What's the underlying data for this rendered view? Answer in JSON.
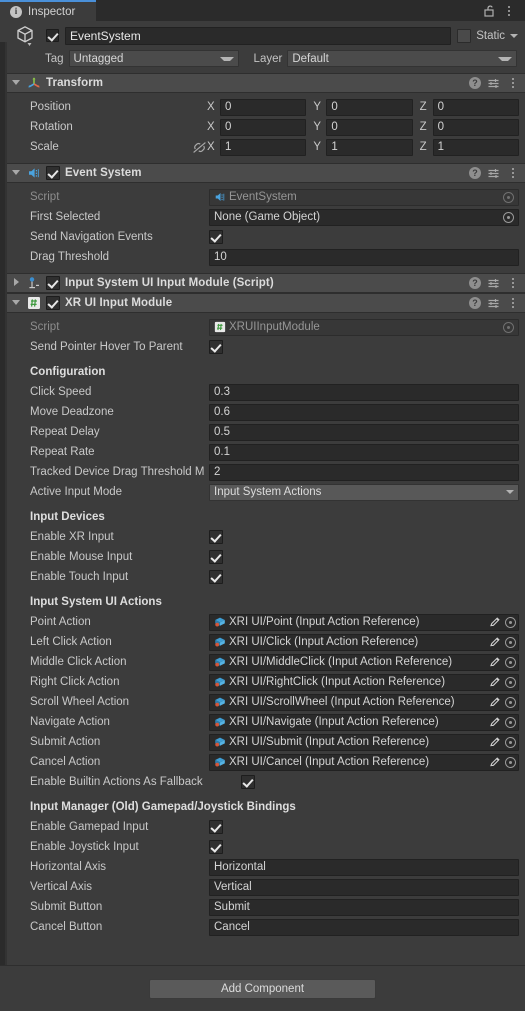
{
  "window": {
    "tab_label": "Inspector",
    "tab_icon": "info-icon",
    "lock_icon": "lock-open-icon",
    "menu_icon": "kebab-menu-icon",
    "accent_color": "#4a90d9"
  },
  "gameobject": {
    "icon": "cube-icon",
    "enabled": true,
    "name": "EventSystem",
    "static_label": "Static",
    "static_checked": false,
    "tag_label": "Tag",
    "tag_value": "Untagged",
    "layer_label": "Layer",
    "layer_value": "Default"
  },
  "components": [
    {
      "id": "transform",
      "title": "Transform",
      "icon": "transform-axis-icon",
      "expanded": true,
      "has_checkbox": false,
      "header_icons": [
        "help-icon",
        "preset-icon",
        "kebab-menu-icon"
      ],
      "vectors": [
        {
          "label": "Position",
          "x": "0",
          "y": "0",
          "z": "0",
          "link": false
        },
        {
          "label": "Rotation",
          "x": "0",
          "y": "0",
          "z": "0",
          "link": false
        },
        {
          "label": "Scale",
          "x": "1",
          "y": "1",
          "z": "1",
          "link": true,
          "link_icon": "constrained-proportions-off-icon"
        }
      ],
      "axis_labels": [
        "X",
        "Y",
        "Z"
      ]
    },
    {
      "id": "event-system",
      "title": "Event System",
      "icon": "event-system-icon",
      "expanded": true,
      "has_checkbox": true,
      "checked": true,
      "header_icons": [
        "help-icon",
        "preset-icon",
        "kebab-menu-icon"
      ],
      "rows": [
        {
          "type": "object",
          "label": "Script",
          "value": "EventSystem",
          "readonly": true,
          "icon": "event-system-icon"
        },
        {
          "type": "object",
          "label": "First Selected",
          "value": "None (Game Object)",
          "readonly": false
        },
        {
          "type": "bool",
          "label": "Send Navigation Events",
          "value": true
        },
        {
          "type": "text",
          "label": "Drag Threshold",
          "value": "10"
        }
      ]
    },
    {
      "id": "input-system-ui-input-module",
      "title": "Input System UI Input Module (Script)",
      "icon": "input-system-icon",
      "expanded": false,
      "has_checkbox": true,
      "checked": true,
      "header_icons": [
        "help-icon",
        "preset-icon",
        "kebab-menu-icon"
      ],
      "rows": []
    },
    {
      "id": "xr-ui-input-module",
      "title": "XR UI Input Module",
      "icon": "csharp-script-icon",
      "expanded": true,
      "has_checkbox": true,
      "checked": true,
      "header_icons": [
        "help-icon",
        "preset-icon",
        "kebab-menu-icon"
      ],
      "rows": [
        {
          "type": "object",
          "label": "Script",
          "value": "XRUIInputModule",
          "readonly": true,
          "icon": "csharp-script-icon"
        },
        {
          "type": "bool",
          "label": "Send Pointer Hover To Parent",
          "value": true
        },
        {
          "type": "header",
          "label": "Configuration"
        },
        {
          "type": "text",
          "label": "Click Speed",
          "value": "0.3"
        },
        {
          "type": "text",
          "label": "Move Deadzone",
          "value": "0.6"
        },
        {
          "type": "text",
          "label": "Repeat Delay",
          "value": "0.5"
        },
        {
          "type": "text",
          "label": "Repeat Rate",
          "value": "0.1"
        },
        {
          "type": "text",
          "label": "Tracked Device Drag Threshold M",
          "value": "2"
        },
        {
          "type": "dropdown",
          "label": "Active Input Mode",
          "value": "Input System Actions"
        },
        {
          "type": "header",
          "label": "Input Devices"
        },
        {
          "type": "bool",
          "label": "Enable XR Input",
          "value": true
        },
        {
          "type": "bool",
          "label": "Enable Mouse Input",
          "value": true
        },
        {
          "type": "bool",
          "label": "Enable Touch Input",
          "value": true
        },
        {
          "type": "header",
          "label": "Input System UI Actions"
        },
        {
          "type": "action",
          "label": "Point Action",
          "value": "XRI UI/Point (Input Action Reference)"
        },
        {
          "type": "action",
          "label": "Left Click Action",
          "value": "XRI UI/Click (Input Action Reference)"
        },
        {
          "type": "action",
          "label": "Middle Click Action",
          "value": "XRI UI/MiddleClick (Input Action Reference)"
        },
        {
          "type": "action",
          "label": "Right Click Action",
          "value": "XRI UI/RightClick (Input Action Reference)"
        },
        {
          "type": "action",
          "label": "Scroll Wheel Action",
          "value": "XRI UI/ScrollWheel (Input Action Reference)"
        },
        {
          "type": "action",
          "label": "Navigate Action",
          "value": "XRI UI/Navigate (Input Action Reference)"
        },
        {
          "type": "action",
          "label": "Submit Action",
          "value": "XRI UI/Submit (Input Action Reference)"
        },
        {
          "type": "action",
          "label": "Cancel Action",
          "value": "XRI UI/Cancel (Input Action Reference)"
        },
        {
          "type": "bool",
          "label": "Enable Builtin Actions As Fallback",
          "value": true,
          "wide_label": true
        },
        {
          "type": "header",
          "label": "Input Manager (Old) Gamepad/Joystick Bindings"
        },
        {
          "type": "bool",
          "label": "Enable Gamepad Input",
          "value": true
        },
        {
          "type": "bool",
          "label": "Enable Joystick Input",
          "value": true
        },
        {
          "type": "text",
          "label": "Horizontal Axis",
          "value": "Horizontal"
        },
        {
          "type": "text",
          "label": "Vertical Axis",
          "value": "Vertical"
        },
        {
          "type": "text",
          "label": "Submit Button",
          "value": "Submit"
        },
        {
          "type": "text",
          "label": "Cancel Button",
          "value": "Cancel"
        }
      ]
    }
  ],
  "footer": {
    "add_component_label": "Add Component"
  }
}
